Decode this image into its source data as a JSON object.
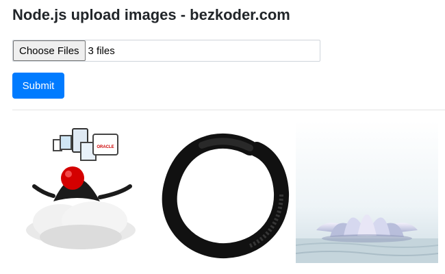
{
  "page": {
    "title": "Node.js upload images - bezkoder.com"
  },
  "upload_form": {
    "choose_files_label": "Choose Files",
    "selected_files_text": "3 files",
    "submit_label": "Submit",
    "submit_color": "#007bff"
  },
  "gallery": {
    "images": [
      {
        "subject": "Java Duke mascot meditating on a cloud with devices"
      },
      {
        "subject": "Black ink enso circle"
      },
      {
        "subject": "Lotus flower on water"
      }
    ],
    "oracle_badge_text": "ORACLE"
  }
}
